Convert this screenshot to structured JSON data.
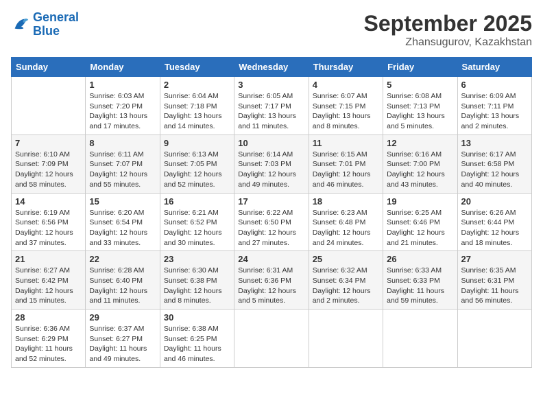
{
  "header": {
    "logo_line1": "General",
    "logo_line2": "Blue",
    "month": "September 2025",
    "location": "Zhansugurov, Kazakhstan"
  },
  "days_of_week": [
    "Sunday",
    "Monday",
    "Tuesday",
    "Wednesday",
    "Thursday",
    "Friday",
    "Saturday"
  ],
  "weeks": [
    [
      {
        "day": "",
        "info": ""
      },
      {
        "day": "1",
        "info": "Sunrise: 6:03 AM\nSunset: 7:20 PM\nDaylight: 13 hours\nand 17 minutes."
      },
      {
        "day": "2",
        "info": "Sunrise: 6:04 AM\nSunset: 7:18 PM\nDaylight: 13 hours\nand 14 minutes."
      },
      {
        "day": "3",
        "info": "Sunrise: 6:05 AM\nSunset: 7:17 PM\nDaylight: 13 hours\nand 11 minutes."
      },
      {
        "day": "4",
        "info": "Sunrise: 6:07 AM\nSunset: 7:15 PM\nDaylight: 13 hours\nand 8 minutes."
      },
      {
        "day": "5",
        "info": "Sunrise: 6:08 AM\nSunset: 7:13 PM\nDaylight: 13 hours\nand 5 minutes."
      },
      {
        "day": "6",
        "info": "Sunrise: 6:09 AM\nSunset: 7:11 PM\nDaylight: 13 hours\nand 2 minutes."
      }
    ],
    [
      {
        "day": "7",
        "info": "Sunrise: 6:10 AM\nSunset: 7:09 PM\nDaylight: 12 hours\nand 58 minutes."
      },
      {
        "day": "8",
        "info": "Sunrise: 6:11 AM\nSunset: 7:07 PM\nDaylight: 12 hours\nand 55 minutes."
      },
      {
        "day": "9",
        "info": "Sunrise: 6:13 AM\nSunset: 7:05 PM\nDaylight: 12 hours\nand 52 minutes."
      },
      {
        "day": "10",
        "info": "Sunrise: 6:14 AM\nSunset: 7:03 PM\nDaylight: 12 hours\nand 49 minutes."
      },
      {
        "day": "11",
        "info": "Sunrise: 6:15 AM\nSunset: 7:01 PM\nDaylight: 12 hours\nand 46 minutes."
      },
      {
        "day": "12",
        "info": "Sunrise: 6:16 AM\nSunset: 7:00 PM\nDaylight: 12 hours\nand 43 minutes."
      },
      {
        "day": "13",
        "info": "Sunrise: 6:17 AM\nSunset: 6:58 PM\nDaylight: 12 hours\nand 40 minutes."
      }
    ],
    [
      {
        "day": "14",
        "info": "Sunrise: 6:19 AM\nSunset: 6:56 PM\nDaylight: 12 hours\nand 37 minutes."
      },
      {
        "day": "15",
        "info": "Sunrise: 6:20 AM\nSunset: 6:54 PM\nDaylight: 12 hours\nand 33 minutes."
      },
      {
        "day": "16",
        "info": "Sunrise: 6:21 AM\nSunset: 6:52 PM\nDaylight: 12 hours\nand 30 minutes."
      },
      {
        "day": "17",
        "info": "Sunrise: 6:22 AM\nSunset: 6:50 PM\nDaylight: 12 hours\nand 27 minutes."
      },
      {
        "day": "18",
        "info": "Sunrise: 6:23 AM\nSunset: 6:48 PM\nDaylight: 12 hours\nand 24 minutes."
      },
      {
        "day": "19",
        "info": "Sunrise: 6:25 AM\nSunset: 6:46 PM\nDaylight: 12 hours\nand 21 minutes."
      },
      {
        "day": "20",
        "info": "Sunrise: 6:26 AM\nSunset: 6:44 PM\nDaylight: 12 hours\nand 18 minutes."
      }
    ],
    [
      {
        "day": "21",
        "info": "Sunrise: 6:27 AM\nSunset: 6:42 PM\nDaylight: 12 hours\nand 15 minutes."
      },
      {
        "day": "22",
        "info": "Sunrise: 6:28 AM\nSunset: 6:40 PM\nDaylight: 12 hours\nand 11 minutes."
      },
      {
        "day": "23",
        "info": "Sunrise: 6:30 AM\nSunset: 6:38 PM\nDaylight: 12 hours\nand 8 minutes."
      },
      {
        "day": "24",
        "info": "Sunrise: 6:31 AM\nSunset: 6:36 PM\nDaylight: 12 hours\nand 5 minutes."
      },
      {
        "day": "25",
        "info": "Sunrise: 6:32 AM\nSunset: 6:34 PM\nDaylight: 12 hours\nand 2 minutes."
      },
      {
        "day": "26",
        "info": "Sunrise: 6:33 AM\nSunset: 6:33 PM\nDaylight: 11 hours\nand 59 minutes."
      },
      {
        "day": "27",
        "info": "Sunrise: 6:35 AM\nSunset: 6:31 PM\nDaylight: 11 hours\nand 56 minutes."
      }
    ],
    [
      {
        "day": "28",
        "info": "Sunrise: 6:36 AM\nSunset: 6:29 PM\nDaylight: 11 hours\nand 52 minutes."
      },
      {
        "day": "29",
        "info": "Sunrise: 6:37 AM\nSunset: 6:27 PM\nDaylight: 11 hours\nand 49 minutes."
      },
      {
        "day": "30",
        "info": "Sunrise: 6:38 AM\nSunset: 6:25 PM\nDaylight: 11 hours\nand 46 minutes."
      },
      {
        "day": "",
        "info": ""
      },
      {
        "day": "",
        "info": ""
      },
      {
        "day": "",
        "info": ""
      },
      {
        "day": "",
        "info": ""
      }
    ]
  ]
}
